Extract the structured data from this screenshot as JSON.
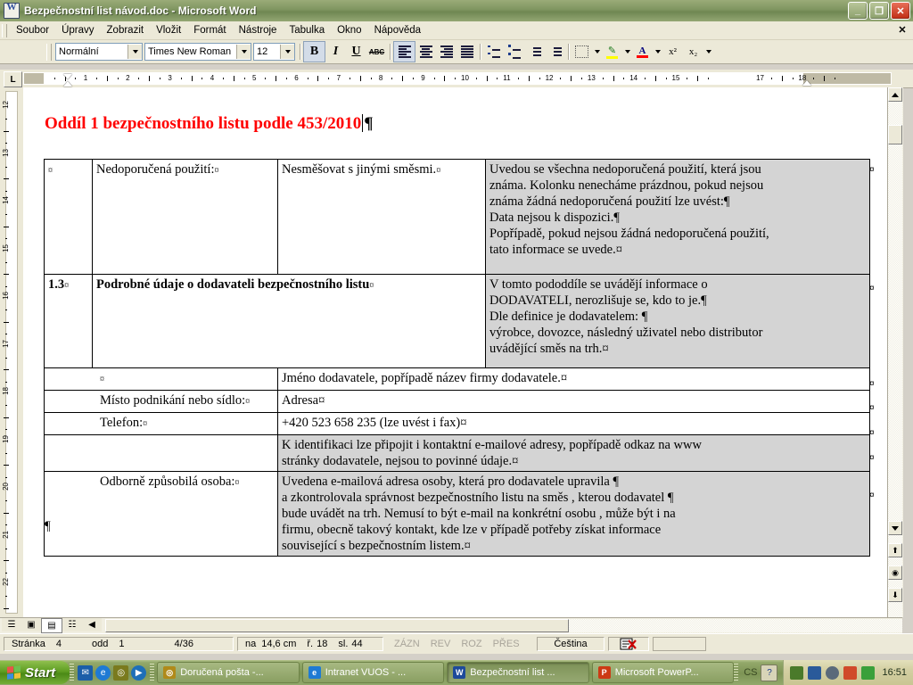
{
  "window": {
    "title": "Bezpečnostní list návod.doc - Microsoft Word",
    "icon": "word-document-icon",
    "minimize": "_",
    "maximize": "❐",
    "close": "✕"
  },
  "menu": {
    "items": [
      "Soubor",
      "Úpravy",
      "Zobrazit",
      "Vložit",
      "Formát",
      "Nástroje",
      "Tabulka",
      "Okno",
      "Nápověda"
    ],
    "close_document": "✕"
  },
  "toolbar": {
    "style": "Normální",
    "font": "Times New Roman",
    "size": "12",
    "bold": "B",
    "italic": "I",
    "underline": "U",
    "strikethrough": "ABC",
    "superscript": "x²",
    "subscript": "x₂",
    "highlight_color": "#ffff00",
    "font_color": "#ff0000",
    "borders_icon": "borders-icon",
    "highlight_icon": "highlight-icon",
    "fontcolor_icon": "font-color-icon"
  },
  "ruler": {
    "tab_marker": "L",
    "horizontal_ticks": [
      "1",
      "2",
      "3",
      "4",
      "5",
      "6",
      "7",
      "8",
      "9",
      "10",
      "11",
      "12",
      "13",
      "14",
      "15",
      "17",
      "18"
    ],
    "vertical_ticks": [
      "12",
      "13",
      "14",
      "15",
      "16",
      "17",
      "18",
      "19",
      "20",
      "21",
      "22"
    ]
  },
  "document": {
    "heading": "Oddíl 1 bezpečnostního listu podle 453/2010",
    "paragraph_mark": "¶",
    "cell_mark": "¤",
    "end_mark": "¶",
    "table": {
      "rows": [
        {
          "id": "row-nedoporucena-pouziti",
          "num": "",
          "num_mark": "¤",
          "label": "Nedoporučená použití:",
          "label_mark": "¤",
          "label_bold": false,
          "value": "Nesměšovat s jinými směsmi.",
          "value_mark": "¤",
          "note_lines": [
            "Uvedou se všechna nedoporučená použití, která jsou",
            "známa. Kolonku nenecháme prázdnou, pokud nejsou",
            "známa žádná nedoporučená použití lze uvést:¶",
            "Data nejsou k dispozici.¶",
            "Popřípadě, pokud nejsou žádná nedoporučená použití,",
            "tato informace se uvede.¤"
          ],
          "shaded": true,
          "layout": "four-col"
        },
        {
          "id": "row-1-3",
          "num": "1.3",
          "num_mark": "¤",
          "label": "Podrobné údaje o dodavateli bezpečnostního listu",
          "label_mark": "¤",
          "label_bold": true,
          "value": "",
          "value_mark": "",
          "note_lines": [
            "V tomto pododdíle se uvádějí informace o",
            "DODAVATELI, nerozlišuje se, kdo to je.¶",
            "Dle definice je dodavatelem: ¶",
            "výrobce, dovozce, následný uživatel  nebo distributor",
            "uvádějící směs na trh.¤"
          ],
          "shaded": true,
          "layout": "span-label"
        },
        {
          "id": "row-jmeno-dodavatele",
          "label": "",
          "label_mark": "¤",
          "note_lines": [
            "Jméno dodavatele, popřípadě název firmy dodavatele.¤"
          ],
          "shaded": false,
          "layout": "two-col"
        },
        {
          "id": "row-misto-podnikani",
          "label": "Místo podnikání nebo sídlo:",
          "label_mark": "¤",
          "note_lines": [
            "Adresa¤"
          ],
          "shaded": false,
          "layout": "two-col"
        },
        {
          "id": "row-telefon",
          "label": "Telefon:",
          "label_mark": "¤",
          "note_lines": [
            "+420 523 658 235 (lze uvést i fax)¤"
          ],
          "shaded": false,
          "layout": "two-col"
        },
        {
          "id": "row-email-info",
          "label": "",
          "label_mark": "",
          "note_lines": [
            "K identifikaci lze připojit i kontaktní e-mailové adresy, popřípadě odkaz na www",
            "stránky dodavatele, nejsou to povinné údaje.¤"
          ],
          "shaded": true,
          "layout": "two-col"
        },
        {
          "id": "row-odborne-zpusobila-osoba",
          "label": "Odborně způsobilá osoba:",
          "label_mark": "¤",
          "note_lines": [
            "Uvedena e-mailová  adresa osoby,  která pro dodavatele upravila ¶",
            "a zkontrolovala správnost bezpečnostního listu na směs ,  kterou dodavatel ¶",
            "bude uvádět na trh. Nemusí to být e-mail na konkrétní osobu , může být i na",
            "firmu, obecně takový kontakt, kde lze v případě potřeby získat informace",
            "související s bezpečnostním listem.¤"
          ],
          "shaded": true,
          "layout": "two-col"
        }
      ]
    }
  },
  "statusbar": {
    "page_label": "Stránka",
    "page": "4",
    "section_label": "odd",
    "section": "1",
    "pages": "4/36",
    "at_label": "na",
    "at": "14,6 cm",
    "line_label": "ř.",
    "line": "18",
    "col_label": "sl.",
    "col": "44",
    "modes": [
      "ZÁZN",
      "REV",
      "ROZ",
      "PŘES"
    ],
    "language": "Čeština",
    "spellcheck_icon": "spellcheck-status-icon"
  },
  "view_buttons": [
    "normal-view",
    "web-layout-view",
    "print-layout-view",
    "outline-view",
    "reading-view"
  ],
  "taskbar": {
    "start": "Start",
    "quick_launch": [
      "outlook-icon",
      "internet-explorer-icon",
      "lotus-notes-icon",
      "media-player-icon"
    ],
    "tasks": [
      {
        "label": "Doručená pošta -...",
        "icon": "mail-icon",
        "active": false
      },
      {
        "label": "Intranet VUOS - ...",
        "icon": "internet-explorer-icon",
        "active": false
      },
      {
        "label": "Bezpečnostní list ...",
        "icon": "word-icon",
        "active": true
      },
      {
        "label": "Microsoft PowerP...",
        "icon": "powerpoint-icon",
        "active": false
      }
    ],
    "language": "CS",
    "help_icon": "help-icon",
    "tray_icons": [
      "printer-icon",
      "network-icon",
      "volume-icon",
      "update-icon",
      "shield-icon"
    ],
    "clock": "16:51"
  }
}
